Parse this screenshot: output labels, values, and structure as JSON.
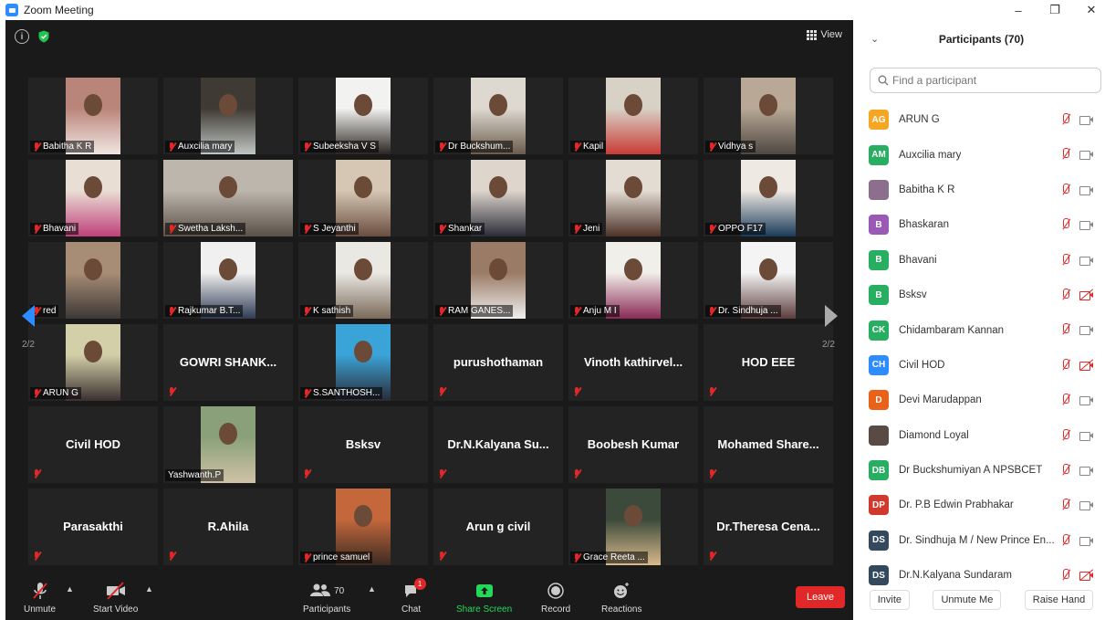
{
  "window": {
    "title": "Zoom Meeting",
    "min": "–",
    "restore": "❐",
    "close": "✕"
  },
  "meeting": {
    "view_label": "View",
    "page_left": "2/2",
    "page_right": "2/2",
    "tiles": [
      {
        "name": "Babitha K R",
        "video": true,
        "colors": [
          "#b9857a",
          "#f1e6e2"
        ]
      },
      {
        "name": "Auxcilia mary",
        "video": true,
        "colors": [
          "#3f3a33",
          "#bfc6c3"
        ]
      },
      {
        "name": "Subeeksha V S",
        "video": true,
        "colors": [
          "#f2f2f0",
          "#2a2522"
        ]
      },
      {
        "name": "Dr Buckshum...",
        "video": true,
        "colors": [
          "#ded9d0",
          "#6b5b4c"
        ]
      },
      {
        "name": "Kapil",
        "video": true,
        "colors": [
          "#d8d2c6",
          "#c83a36"
        ]
      },
      {
        "name": "Vidhya s",
        "video": true,
        "colors": [
          "#b8a895",
          "#4e4742"
        ]
      },
      {
        "name": "Bhavani",
        "video": true,
        "colors": [
          "#e9ded4",
          "#c0407a"
        ]
      },
      {
        "name": "Swetha Laksh...",
        "video": true,
        "wide": true,
        "colors": [
          "#bdb6ad",
          "#5a5048"
        ]
      },
      {
        "name": "S Jeyanthi",
        "video": true,
        "colors": [
          "#d5c7b4",
          "#6a4e3f"
        ]
      },
      {
        "name": "Shankar",
        "video": true,
        "colors": [
          "#ded6cd",
          "#2b2b38"
        ]
      },
      {
        "name": "Jeni",
        "video": true,
        "colors": [
          "#e3dcd3",
          "#4d3227"
        ]
      },
      {
        "name": "OPPO F17",
        "video": true,
        "colors": [
          "#eee9e2",
          "#1a3a5a"
        ]
      },
      {
        "name": "red",
        "video": true,
        "colors": [
          "#a78d76",
          "#3c3836"
        ]
      },
      {
        "name": "Rajkumar B.T...",
        "video": true,
        "colors": [
          "#f0f0f0",
          "#2e3b52"
        ]
      },
      {
        "name": "K sathish",
        "video": true,
        "colors": [
          "#eae8e3",
          "#7a6a5a"
        ]
      },
      {
        "name": "RAM GANES...",
        "video": true,
        "colors": [
          "#9a7b66",
          "#efefef"
        ]
      },
      {
        "name": "Anju M I",
        "video": true,
        "colors": [
          "#f1efe9",
          "#8a2a55"
        ]
      },
      {
        "name": "Dr. Sindhuja ...",
        "video": true,
        "colors": [
          "#f4f4f4",
          "#5c3c3c"
        ]
      },
      {
        "name": "ARUN G",
        "video": true,
        "colors": [
          "#d3cfa8",
          "#3b3030"
        ]
      },
      {
        "name": "GOWRI SHANK...",
        "video": false
      },
      {
        "name": "S.SANTHOSH...",
        "video": true,
        "colors": [
          "#3aa3d8",
          "#2a2a35"
        ]
      },
      {
        "name": "purushothaman",
        "video": false
      },
      {
        "name": "Vinoth kathirvel...",
        "video": false
      },
      {
        "name": "HOD EEE",
        "video": false
      },
      {
        "name": "Civil HOD",
        "video": false
      },
      {
        "name": "Yashwanth.P",
        "video": true,
        "colors": [
          "#8aa07a",
          "#cfc2a6"
        ]
      },
      {
        "name": "Bsksv",
        "video": false
      },
      {
        "name": "Dr.N.Kalyana Su...",
        "video": false
      },
      {
        "name": "Boobesh Kumar",
        "video": false
      },
      {
        "name": "Mohamed Share...",
        "video": false
      },
      {
        "name": "Parasakthi",
        "video": false
      },
      {
        "name": "R.Ahila",
        "video": false
      },
      {
        "name": "prince samuel",
        "video": true,
        "colors": [
          "#c4683c",
          "#3b2b22"
        ]
      },
      {
        "name": "Arun g civil",
        "video": false
      },
      {
        "name": "Grace Reeta ...",
        "video": true,
        "colors": [
          "#3b4a3a",
          "#d8b98c"
        ]
      },
      {
        "name": "Dr.Theresa Cena...",
        "video": false
      }
    ]
  },
  "toolbar": {
    "unmute": "Unmute",
    "start_video": "Start Video",
    "participants": "Participants",
    "participants_count": "70",
    "chat": "Chat",
    "chat_badge": "1",
    "share": "Share Screen",
    "record": "Record",
    "reactions": "Reactions",
    "leave": "Leave"
  },
  "panel": {
    "title": "Participants (70)",
    "search_placeholder": "Find a participant",
    "participants": [
      {
        "initials": "AG",
        "color": "#f5a623",
        "name": "ARUN G",
        "cam_off": false
      },
      {
        "initials": "AM",
        "color": "#27ae60",
        "name": "Auxcilia mary",
        "cam_off": false
      },
      {
        "initials": "",
        "color": "#8c6e8f",
        "name": "Babitha K R",
        "cam_off": false
      },
      {
        "initials": "B",
        "color": "#9b59b6",
        "name": "Bhaskaran",
        "cam_off": false
      },
      {
        "initials": "B",
        "color": "#27ae60",
        "name": "Bhavani",
        "cam_off": false
      },
      {
        "initials": "B",
        "color": "#27ae60",
        "name": "Bsksv",
        "cam_off": true
      },
      {
        "initials": "CK",
        "color": "#27ae60",
        "name": "Chidambaram Kannan",
        "cam_off": false
      },
      {
        "initials": "CH",
        "color": "#2d8cff",
        "name": "Civil HOD",
        "cam_off": true
      },
      {
        "initials": "D",
        "color": "#e8621a",
        "name": "Devi Marudappan",
        "cam_off": false
      },
      {
        "initials": "",
        "color": "#5a4a44",
        "name": "Diamond Loyal",
        "cam_off": false
      },
      {
        "initials": "DB",
        "color": "#27ae60",
        "name": "Dr Buckshumiyan A NPSBCET",
        "cam_off": false
      },
      {
        "initials": "DP",
        "color": "#d0392b",
        "name": "Dr. P.B Edwin Prabhakar",
        "cam_off": false
      },
      {
        "initials": "DS",
        "color": "#34495e",
        "name": "Dr. Sindhuja M / New Prince En...",
        "cam_off": false
      },
      {
        "initials": "DS",
        "color": "#34495e",
        "name": "Dr.N.Kalyana Sundaram",
        "cam_off": true
      }
    ],
    "invite": "Invite",
    "unmute_me": "Unmute Me",
    "raise_hand": "Raise Hand"
  }
}
